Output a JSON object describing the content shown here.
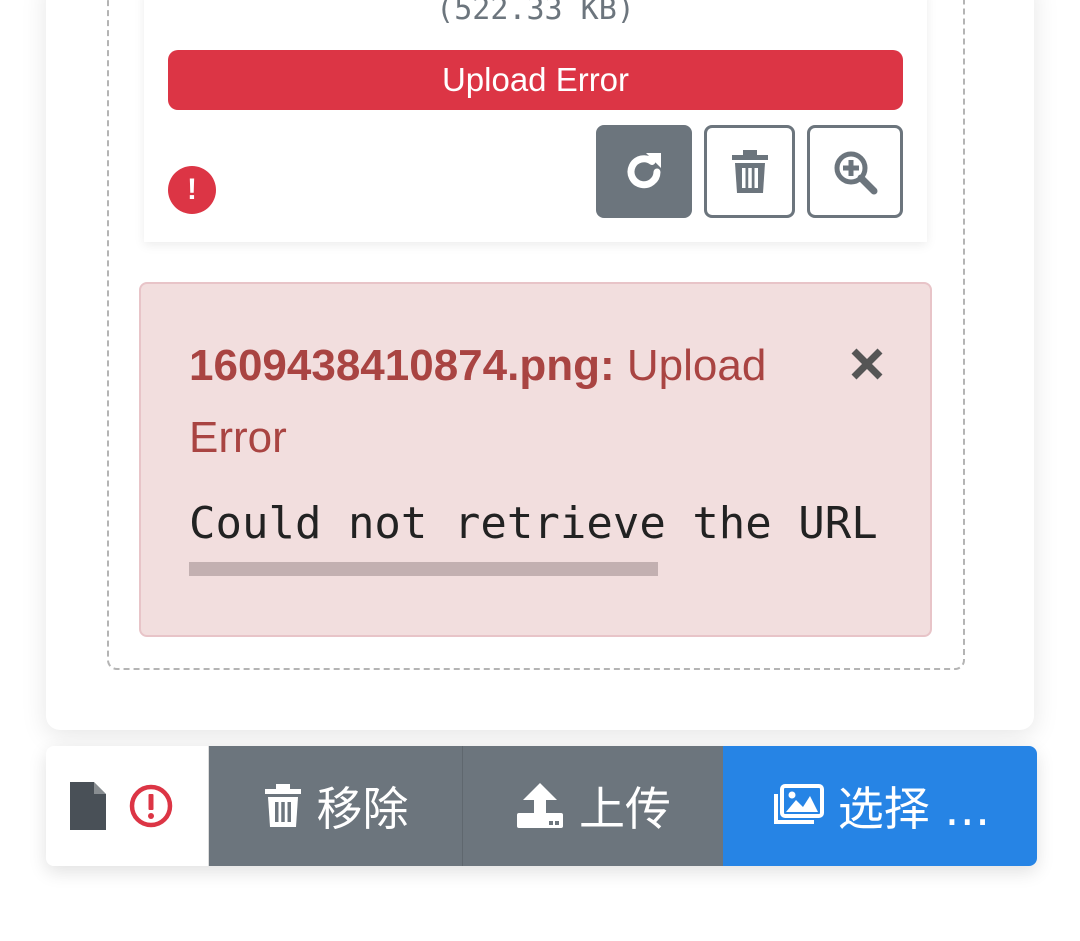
{
  "preview": {
    "file_size": "(522.33 KB)",
    "status": "Upload Error",
    "status_color": "#dc3545",
    "error_icon": "exclamation-circle-icon",
    "actions": {
      "retry_icon": "redo-icon",
      "delete_icon": "trash-icon",
      "zoom_icon": "zoom-in-icon"
    }
  },
  "alert": {
    "filename": "1609438410874.png:",
    "title": "Upload Error",
    "message": "Could not retrieve the URL",
    "close_icon": "close-icon",
    "color": "#a94442",
    "background": "#f2dede"
  },
  "toolbar": {
    "caption_file_icon": "file-icon",
    "caption_status_icon": "exclamation-circle-icon",
    "remove_label": "移除",
    "upload_label": "上传",
    "browse_label": "选择 …",
    "browse_color": "#2684e5",
    "secondary_color": "#6c757d"
  }
}
